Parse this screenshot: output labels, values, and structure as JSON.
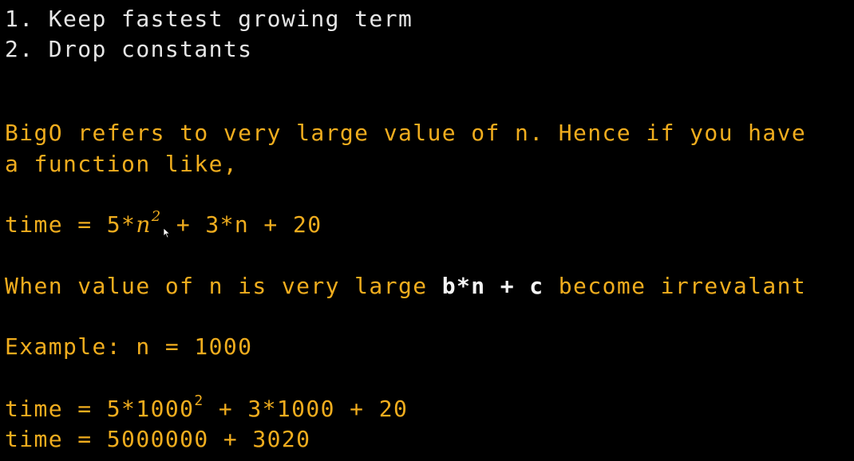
{
  "list": {
    "item1": "1. Keep fastest growing term",
    "item2": "2. Drop constants"
  },
  "intro": {
    "line1": "BigO refers to very large value of n. Hence if you have",
    "line2": "a function like,"
  },
  "formula": {
    "prefix": "time = 5*",
    "var": "n",
    "exp": "2",
    "suffix": " + 3*n + 20"
  },
  "statement": {
    "before": "When value of n is very large ",
    "bold": "b*n + c",
    "after": " become irrevalant"
  },
  "example": {
    "label": "Example: n = 1000"
  },
  "calc1": {
    "prefix": "time = 5*1000",
    "exp": "2",
    "suffix": " + 3*1000 + 20"
  },
  "calc2": {
    "text": "time = 5000000 + 3020"
  },
  "colors": {
    "background": "#000000",
    "white_text": "#e6e6e6",
    "amber_text": "#f0ad1e"
  },
  "icons": {
    "cursor": "mouse-pointer-icon"
  }
}
